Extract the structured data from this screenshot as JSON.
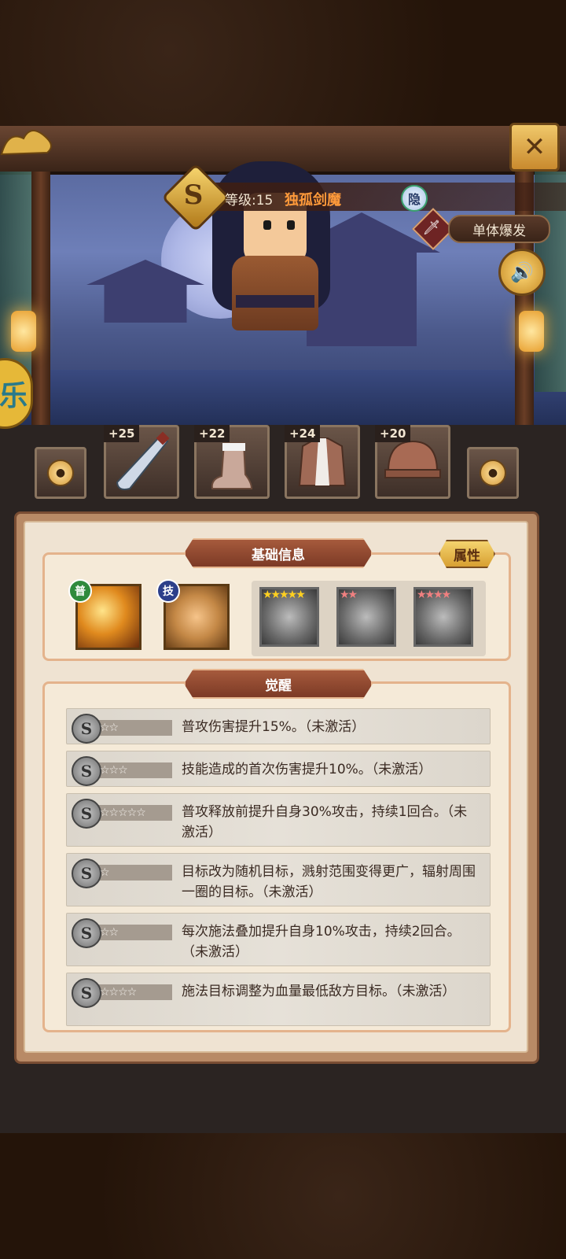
{
  "hero": {
    "rank": "S",
    "level_label": "等级:15",
    "name": "独孤剑魔",
    "hidden_badge": "隐",
    "type_tag": "单体爆发",
    "left_badge": "乐"
  },
  "buttons": {
    "close": "✕",
    "sound_icon": "speaker-icon"
  },
  "equipment": [
    {
      "slot": "locked-left",
      "locked": true
    },
    {
      "slot": "weapon",
      "plus": "+25",
      "icon": "sword-icon"
    },
    {
      "slot": "boots",
      "plus": "+22",
      "icon": "boots-icon"
    },
    {
      "slot": "armor",
      "plus": "+24",
      "icon": "armor-icon"
    },
    {
      "slot": "helmet",
      "plus": "+20",
      "icon": "helmet-icon"
    },
    {
      "slot": "locked-right",
      "locked": true
    }
  ],
  "basic_info": {
    "title": "基础信息",
    "attr_button": "属性",
    "skills": [
      {
        "tag": "普",
        "tag_color": "#2f8a3c",
        "icon": "fire-slash-icon"
      },
      {
        "tag": "技",
        "tag_color": "#2c3f8a",
        "icon": "hand-flower-icon"
      }
    ],
    "locked_skills": [
      {
        "stars": "★★★★★",
        "stars_count": 5,
        "star_color": "#ffd020",
        "icon": "gray-slash-icon"
      },
      {
        "stars": "★★",
        "stars_count": 2,
        "star_color": "#f08080",
        "icon": "gray-hand-icon"
      },
      {
        "stars": "★★★★",
        "stars_count": 4,
        "star_color": "#f08080",
        "icon": "gray-hand-icon"
      }
    ]
  },
  "awakening": {
    "title": "觉醒",
    "rows": [
      {
        "stars": "☆☆",
        "text": "普攻伤害提升15%。（未激活）"
      },
      {
        "stars": "☆☆☆",
        "text": "技能造成的首次伤害提升10%。（未激活）"
      },
      {
        "stars": "☆☆☆☆☆",
        "text": "普攻释放前提升自身30%攻击，持续1回合。（未激活）"
      },
      {
        "stars": "☆",
        "text": "目标改为随机目标，溅射范围变得更广，辐射周围一圈的目标。（未激活）"
      },
      {
        "stars": "☆☆",
        "text": "每次施法叠加提升自身10%攻击，持续2回合。（未激活）"
      },
      {
        "stars": "☆☆☆☆",
        "text": "施法目标调整为血量最低敌方目标。（未激活）"
      }
    ]
  }
}
